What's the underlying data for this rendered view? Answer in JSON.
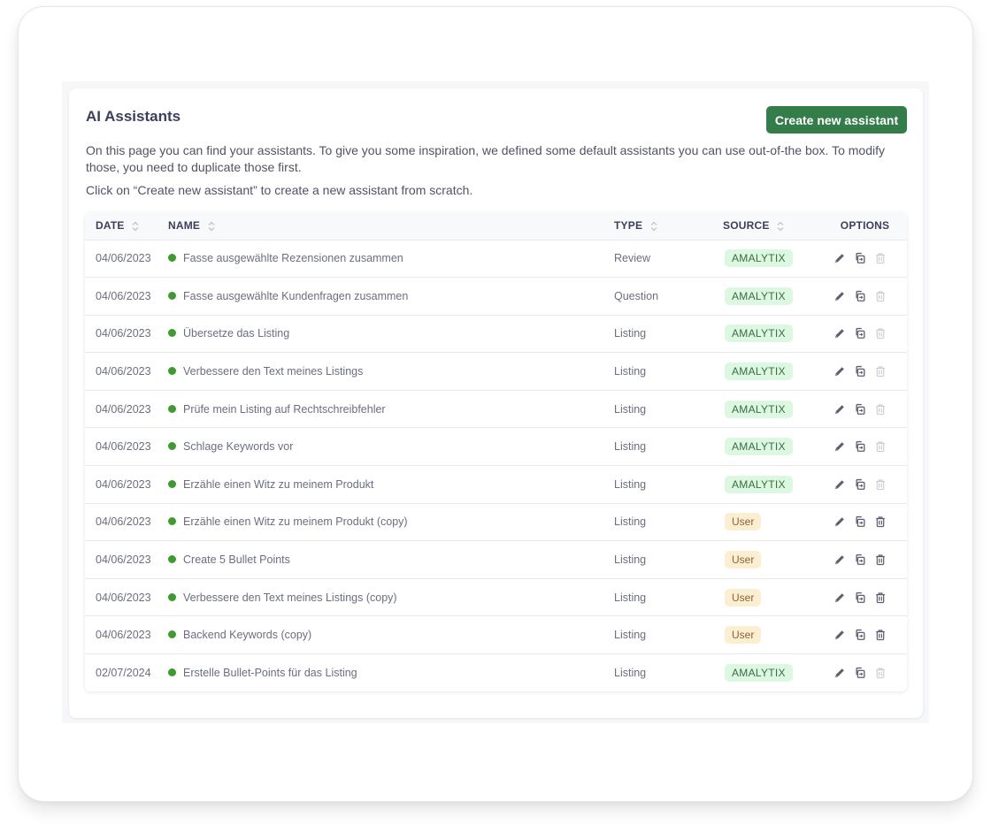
{
  "page": {
    "title": "AI Assistants",
    "create_button": "Create new assistant",
    "description": "On this page you can find your assistants. To give you some inspiration, we defined some default assistants you can use out-of-the box. To modify those, you need to duplicate those first.",
    "hint": "Click on “Create new assistant” to create a new assistant from scratch."
  },
  "colors": {
    "primary_button": "#357c4b",
    "status_active": "#3d9b2f",
    "badge_amalytix_bg": "#ddf8e1",
    "badge_user_bg": "#fcefd1"
  },
  "table": {
    "columns": {
      "date": "DATE",
      "name": "NAME",
      "type": "TYPE",
      "source": "SOURCE",
      "options": "OPTIONS"
    },
    "rows": [
      {
        "date": "04/06/2023",
        "name": "Fasse ausgewählte Rezensionen zusammen",
        "type": "Review",
        "source": "AMALYTIX",
        "status": "active",
        "delete_enabled": false
      },
      {
        "date": "04/06/2023",
        "name": "Fasse ausgewählte Kundenfragen zusammen",
        "type": "Question",
        "source": "AMALYTIX",
        "status": "active",
        "delete_enabled": false
      },
      {
        "date": "04/06/2023",
        "name": "Übersetze das Listing",
        "type": "Listing",
        "source": "AMALYTIX",
        "status": "active",
        "delete_enabled": false
      },
      {
        "date": "04/06/2023",
        "name": "Verbessere den Text meines Listings",
        "type": "Listing",
        "source": "AMALYTIX",
        "status": "active",
        "delete_enabled": false
      },
      {
        "date": "04/06/2023",
        "name": "Prüfe mein Listing auf Rechtschreibfehler",
        "type": "Listing",
        "source": "AMALYTIX",
        "status": "active",
        "delete_enabled": false
      },
      {
        "date": "04/06/2023",
        "name": "Schlage Keywords vor",
        "type": "Listing",
        "source": "AMALYTIX",
        "status": "active",
        "delete_enabled": false
      },
      {
        "date": "04/06/2023",
        "name": "Erzähle einen Witz zu meinem Produkt",
        "type": "Listing",
        "source": "AMALYTIX",
        "status": "active",
        "delete_enabled": false
      },
      {
        "date": "04/06/2023",
        "name": "Erzähle einen Witz zu meinem Produkt (copy)",
        "type": "Listing",
        "source": "User",
        "status": "active",
        "delete_enabled": true
      },
      {
        "date": "04/06/2023",
        "name": "Create 5 Bullet Points",
        "type": "Listing",
        "source": "User",
        "status": "active",
        "delete_enabled": true
      },
      {
        "date": "04/06/2023",
        "name": "Verbessere den Text meines Listings (copy)",
        "type": "Listing",
        "source": "User",
        "status": "active",
        "delete_enabled": true
      },
      {
        "date": "04/06/2023",
        "name": "Backend Keywords (copy)",
        "type": "Listing",
        "source": "User",
        "status": "active",
        "delete_enabled": true
      },
      {
        "date": "02/07/2024",
        "name": "Erstelle Bullet-Points für das Listing",
        "type": "Listing",
        "source": "AMALYTIX",
        "status": "active",
        "delete_enabled": false
      }
    ],
    "row_icons": [
      "edit-icon",
      "duplicate-icon",
      "delete-icon"
    ]
  }
}
